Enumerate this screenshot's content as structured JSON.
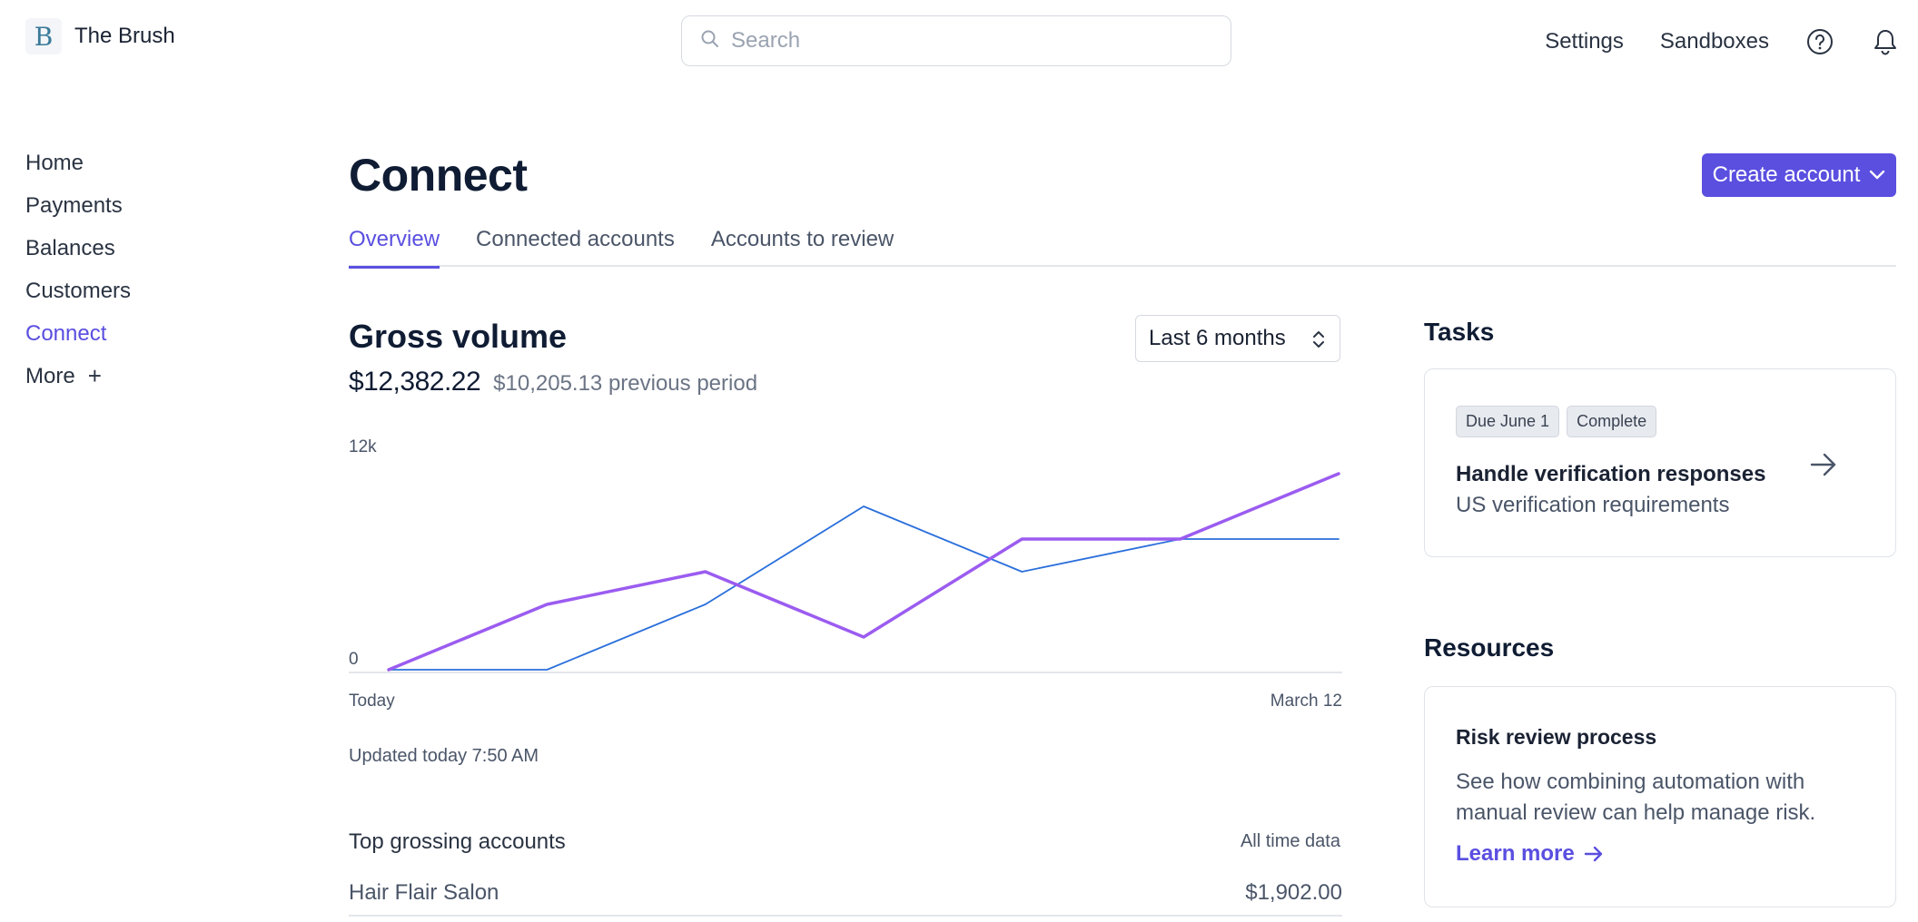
{
  "brand": {
    "logo_letter": "B",
    "name": "The Brush"
  },
  "search": {
    "placeholder": "Search"
  },
  "top_nav": {
    "settings": "Settings",
    "sandboxes": "Sandboxes"
  },
  "sidebar": {
    "items": [
      {
        "label": "Home"
      },
      {
        "label": "Payments"
      },
      {
        "label": "Balances"
      },
      {
        "label": "Customers"
      },
      {
        "label": "Connect"
      },
      {
        "label": "More",
        "suffix": "+"
      }
    ]
  },
  "page": {
    "title": "Connect",
    "create_button": "Create account",
    "tabs": [
      {
        "label": "Overview"
      },
      {
        "label": "Connected accounts"
      },
      {
        "label": "Accounts to review"
      }
    ]
  },
  "gross_volume": {
    "title": "Gross volume",
    "period": "Last 6 months",
    "amount": "$12,382.22",
    "previous": "$10,205.13 previous period",
    "updated": "Updated today 7:50 AM"
  },
  "chart_data": {
    "type": "line",
    "x_start_label": "Today",
    "x_end_label": "March 12",
    "y_ticks": [
      "12k",
      "0"
    ],
    "ylim": [
      0,
      12000
    ],
    "series": [
      {
        "color": "#9b5cf0",
        "values": [
          0,
          4000,
          6000,
          2000,
          8000,
          8000,
          12000
        ]
      },
      {
        "color": "#2a6fdb",
        "values": [
          0,
          0,
          4000,
          10000,
          6000,
          8000,
          8000
        ]
      }
    ]
  },
  "top_accounts": {
    "title": "Top grossing accounts",
    "scope": "All time data",
    "rows": [
      {
        "name": "Hair Flair Salon",
        "amount": "$1,902.00"
      }
    ]
  },
  "tasks": {
    "title": "Tasks",
    "badges": [
      "Due June 1",
      "Complete"
    ],
    "task_title": "Handle verification responses",
    "task_sub": "US verification requirements"
  },
  "resources": {
    "title": "Resources",
    "card_title": "Risk review process",
    "card_desc": "See how combining automation with manual review can help manage risk.",
    "link": "Learn more"
  },
  "colors": {
    "accent": "#5b4fe0",
    "line_primary": "#9b5cf0",
    "line_secondary": "#2a6fdb"
  }
}
